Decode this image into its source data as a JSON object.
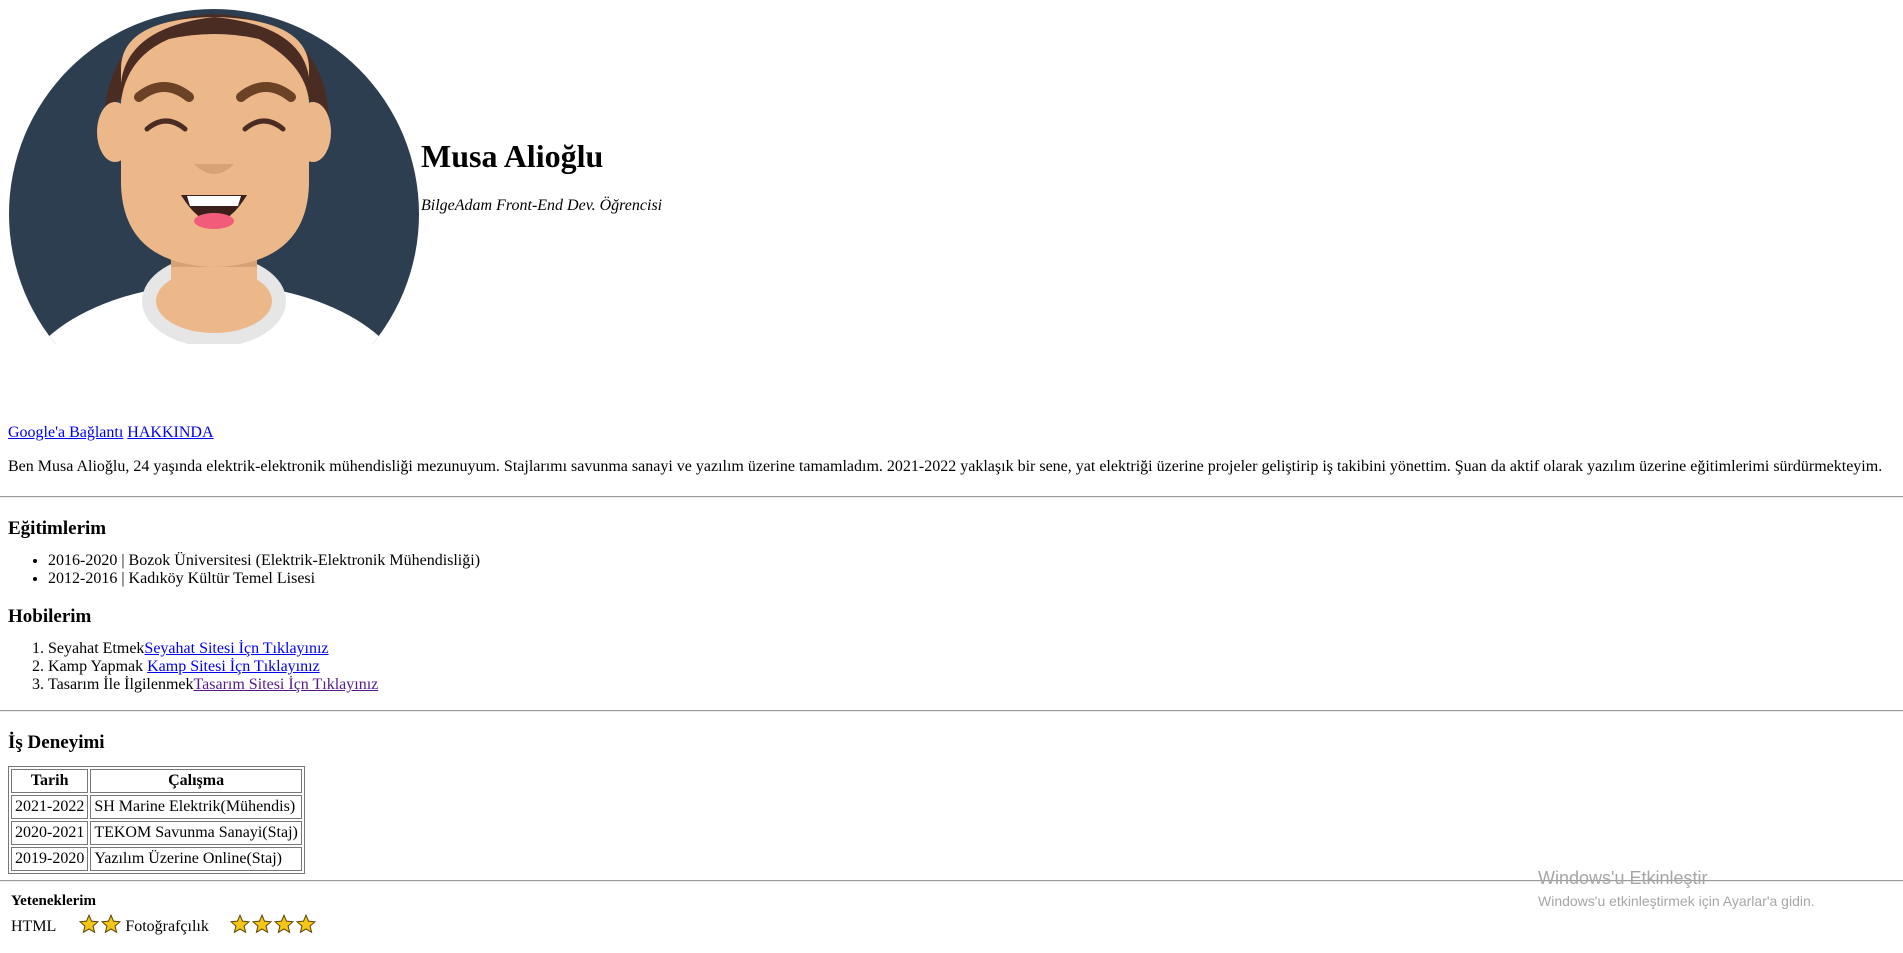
{
  "profile": {
    "name": "Musa Alioğlu",
    "tagline": "BilgeAdam Front-End Dev. Öğrencisi",
    "avatar_icon": "cartoon-avatar"
  },
  "links": {
    "google": "Google'a Bağlantı",
    "about": "HAKKINDA"
  },
  "about_text": "Ben Musa Alioğlu, 24 yaşında elektrik-elektronik mühendisliği mezunuyum. Stajlarımı savunma sanayi ve yazılım üzerine tamamladım. 2021-2022 yaklaşık bir sene, yat elektriği üzerine projeler geliştirip iş takibini yönettim. Şuan da aktif olarak yazılım üzerine eğitimlerimi sürdürmekteyim.",
  "education": {
    "title": "Eğitimlerim",
    "items": [
      {
        "years": "2016-2020",
        "sep": " | ",
        "school": "Bozok Üniversitesi (Elektrik-Elektronik Mühendisliği)"
      },
      {
        "years": "2012-2016",
        "sep": " | ",
        "school": "Kadıköy Kültür Temel Lisesi"
      }
    ]
  },
  "hobbies": {
    "title": "Hobilerim",
    "items": [
      {
        "text": "Seyahat Etmek",
        "link": "Seyahat Sitesi İçn Tıklayınız"
      },
      {
        "text": "Kamp Yapmak ",
        "link": "Kamp Sitesi İçn Tıklayınız"
      },
      {
        "text": "Tasarım İle İlgilenmek",
        "link": "Tasarım Sitesi İçn Tıklayınız"
      }
    ]
  },
  "work": {
    "title": "İş Deneyimi",
    "headers": [
      "Tarih",
      "Çalışma"
    ],
    "rows": [
      [
        "2021-2022",
        "SH Marine Elektrik(Mühendis)"
      ],
      [
        "2020-2021",
        "TEKOM Savunma Sanayi(Staj)"
      ],
      [
        "2019-2020",
        "Yazılım Üzerine Online(Staj)"
      ]
    ]
  },
  "skills": {
    "title": "Yeteneklerim",
    "items": [
      {
        "label": "HTML",
        "stars": 2
      },
      {
        "label": "Fotoğrafçılık",
        "stars": 4
      }
    ]
  },
  "watermark": {
    "line1": "Windows'u Etkinleştir",
    "line2": "Windows'u etkinleştirmek için Ayarlar'a gidin."
  },
  "colors": {
    "link": "#0000ee",
    "visited_link": "#551a8b",
    "star": "#f5c518",
    "avatar_bg": "#2c3e50",
    "skin": "#ecb88a",
    "hair": "#4a2c22"
  }
}
